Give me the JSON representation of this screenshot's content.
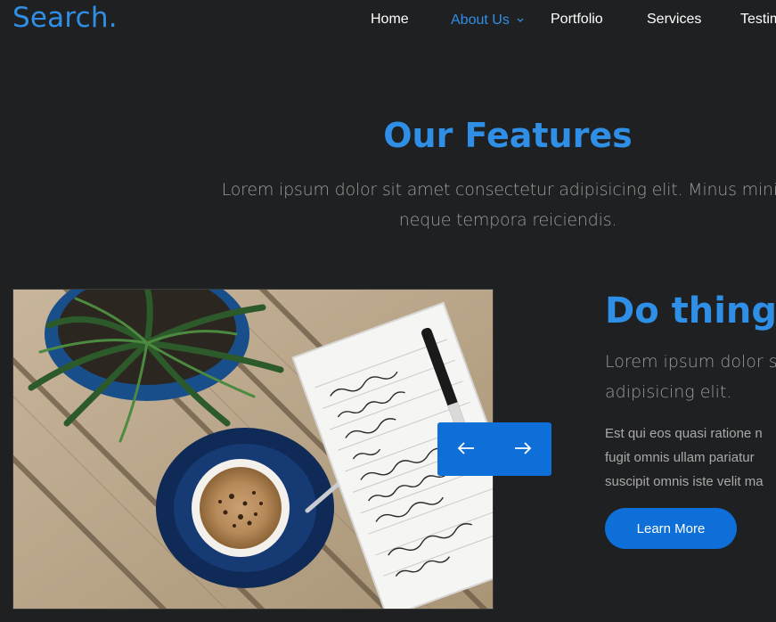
{
  "brand": {
    "logo": "Search."
  },
  "nav": {
    "items": [
      {
        "label": "Home"
      },
      {
        "label": "About Us"
      },
      {
        "label": "Portfolio"
      },
      {
        "label": "Services"
      },
      {
        "label": "Testim"
      }
    ],
    "active_index": 1
  },
  "features": {
    "title": "Our Features",
    "subtitle_line1": "Lorem ipsum dolor sit amet consectetur adipisicing elit. Minus minim",
    "subtitle_line2": "neque tempora reiciendis."
  },
  "feature_item": {
    "heading": "Do things",
    "lead_line1": "Lorem ipsum dolor sit",
    "lead_line2": "adipisicing elit.",
    "body_line1": "Est qui eos quasi ratione n",
    "body_line2": "fugit omnis ullam pariatur",
    "body_line3": "suscipit omnis iste velit ma",
    "cta_label": "Learn More"
  },
  "slider": {
    "prev_icon": "arrow-left-icon",
    "next_icon": "arrow-right-icon"
  },
  "colors": {
    "background": "#1f2022",
    "accent": "#2f8fe6",
    "button": "#0f6fd8"
  }
}
